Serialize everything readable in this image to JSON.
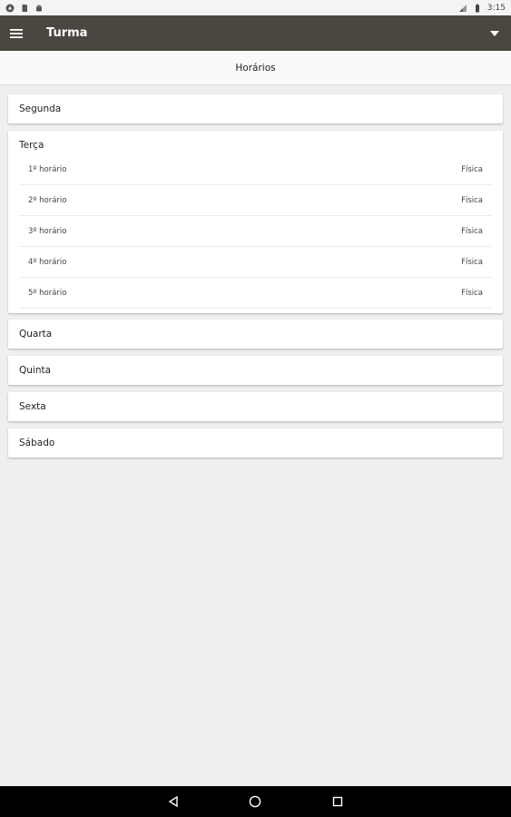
{
  "status_bar": {
    "time": "3:15"
  },
  "app_bar": {
    "title": "Turma"
  },
  "page_header": {
    "title": "Horários"
  },
  "days": [
    {
      "name": "Segunda"
    },
    {
      "name": "Terça"
    },
    {
      "name": "Quarta"
    },
    {
      "name": "Quinta"
    },
    {
      "name": "Sexta"
    },
    {
      "name": "Sábado"
    }
  ],
  "terca_periods": [
    {
      "period": "1º horário",
      "subject": "Física"
    },
    {
      "period": "2º horário",
      "subject": "Física"
    },
    {
      "period": "3º horário",
      "subject": "Física"
    },
    {
      "period": "4º horário",
      "subject": "Física"
    },
    {
      "period": "5º horário",
      "subject": "Física"
    }
  ]
}
